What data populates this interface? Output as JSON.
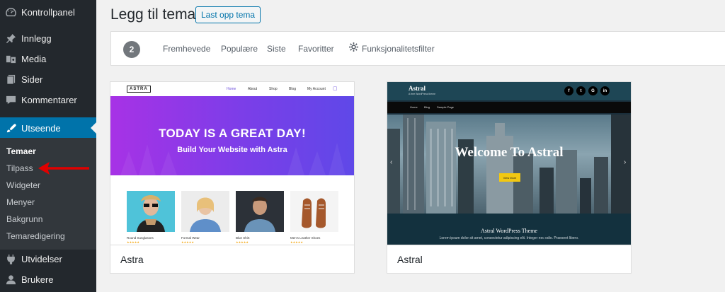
{
  "sidebar": {
    "items": [
      {
        "label": "Kontrollpanel",
        "icon": "dashboard-icon"
      },
      {
        "label": "Innlegg",
        "icon": "pin-icon"
      },
      {
        "label": "Media",
        "icon": "media-icon"
      },
      {
        "label": "Sider",
        "icon": "pages-icon"
      },
      {
        "label": "Kommentarer",
        "icon": "comments-icon"
      },
      {
        "label": "Utseende",
        "icon": "appearance-icon"
      },
      {
        "label": "Utvidelser",
        "icon": "plugins-icon"
      },
      {
        "label": "Brukere",
        "icon": "users-icon"
      }
    ],
    "submenu": [
      "Temaer",
      "Tilpass",
      "Widgeter",
      "Menyer",
      "Bakgrunn",
      "Temaredigering"
    ]
  },
  "header": {
    "title": "Legg til tema",
    "upload_button": "Last opp tema"
  },
  "filter": {
    "count": "2",
    "links": [
      "Fremhevede",
      "Populære",
      "Siste",
      "Favoritter"
    ],
    "feature_filter": "Funksjonalitetsfilter"
  },
  "themes": [
    {
      "name": "Astra",
      "preview": {
        "logo": "ASTRA",
        "nav": [
          "Home",
          "About",
          "Shop",
          "Blog",
          "My Account"
        ],
        "hero_title": "TODAY IS A GREAT DAY!",
        "hero_subtitle": "Build Your Website with Astra",
        "products": [
          "Round Sunglasses",
          "Formal Wear",
          "Blue Shirt",
          "Men's Leather Shoes"
        ],
        "stars": "★★★★★"
      }
    },
    {
      "name": "Astral",
      "preview": {
        "logo": "Astral",
        "tagline": "A free WordPress theme",
        "nav": [
          "Home",
          "Blog",
          "Sample Page"
        ],
        "hero_title": "Welcome To Astral",
        "hero_button": "View More",
        "band_title": "Astral WordPress Theme",
        "band_text": "Lorem ipsum dolor sit amet, consectetur adipiscing elit. Integer nec odio. Praesent libero."
      }
    }
  ],
  "colors": {
    "sidebar_bg": "#23282d",
    "active": "#0073aa",
    "arrow": "#e00000",
    "astra_purple": "#7b3ee8",
    "astral_teal": "#1e4655"
  }
}
